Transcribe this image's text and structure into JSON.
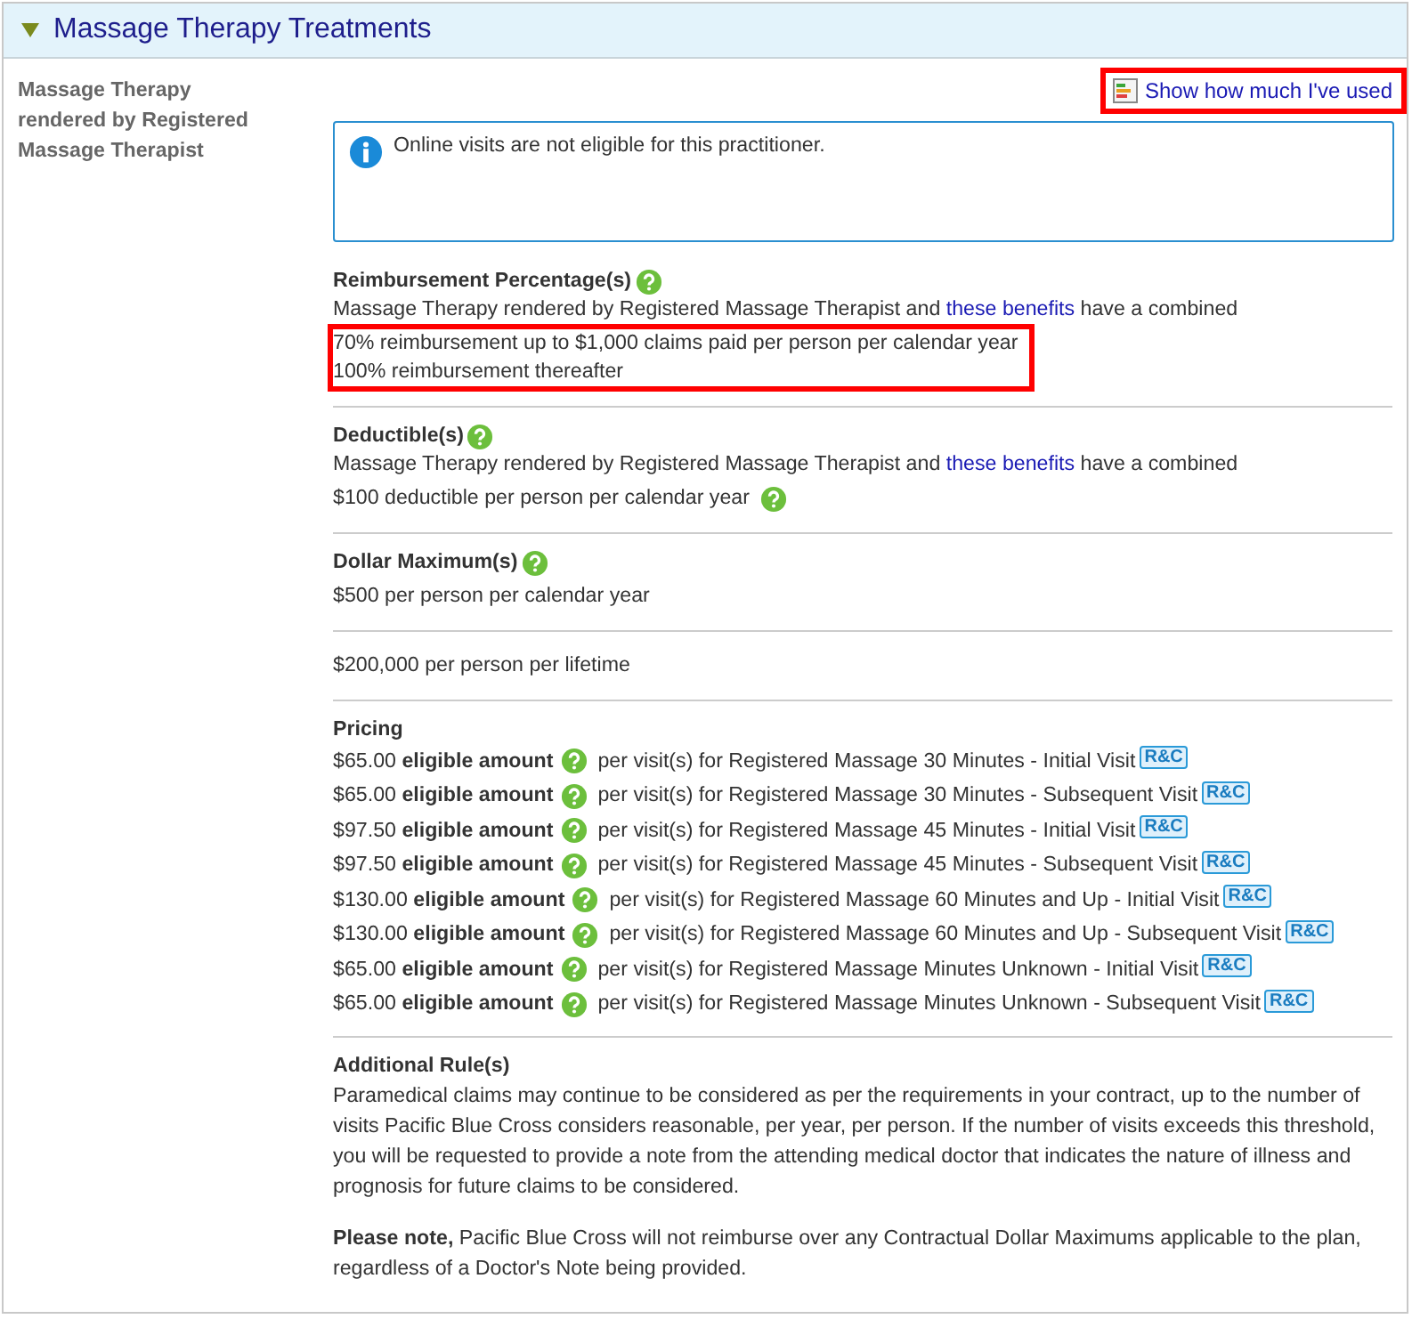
{
  "section": {
    "title": "Massage Therapy Treatments",
    "expanded": true,
    "label": "Massage Therapy rendered by Registered Massage Therapist",
    "usage_link": {
      "text": "Show how much I've used",
      "highlighted": true
    },
    "notice": "Online visits are not eligible for this practitioner.",
    "blocks": [
      {
        "kind": "text",
        "heading": "Reimbursement Percentage(s)",
        "heading_help": true,
        "intro": {
          "before": "Massage Therapy rendered by Registered Massage Therapist and ",
          "link": "these benefits",
          "after": " have a combined"
        },
        "highlighted": true,
        "lines": [
          {
            "text": "70% reimbursement up to $1,000 claims paid per person per calendar year",
            "help": false
          },
          {
            "text": "100% reimbursement thereafter",
            "help": false
          }
        ]
      },
      {
        "kind": "text",
        "heading": "Deductible(s)",
        "heading_help": true,
        "intro": {
          "before": "Massage Therapy rendered by Registered Massage Therapist and ",
          "link": "these benefits",
          "after": " have a combined"
        },
        "highlighted": false,
        "lines": [
          {
            "text": "$100 deductible per person per calendar year",
            "help": true
          }
        ]
      },
      {
        "kind": "text",
        "heading": "Dollar Maximum(s)",
        "heading_help": true,
        "highlighted": false,
        "lines": [
          {
            "text": "$500 per person per calendar year",
            "help": false
          }
        ]
      },
      {
        "kind": "text",
        "highlighted": false,
        "lines": [
          {
            "text": "$200,000 per person per lifetime",
            "help": false
          }
        ]
      },
      {
        "kind": "pricing",
        "heading": "Pricing",
        "rows": [
          {
            "amount": "$65.00",
            "label": "eligible amount",
            "description": "per visit(s) for Registered Massage 30 Minutes - Initial Visit",
            "tag": "R&C"
          },
          {
            "amount": "$65.00",
            "label": "eligible amount",
            "description": "per visit(s) for Registered Massage 30 Minutes - Subsequent Visit",
            "tag": "R&C"
          },
          {
            "amount": "$97.50",
            "label": "eligible amount",
            "description": "per visit(s) for Registered Massage 45 Minutes - Initial Visit",
            "tag": "R&C"
          },
          {
            "amount": "$97.50",
            "label": "eligible amount",
            "description": "per visit(s) for Registered Massage 45 Minutes - Subsequent Visit",
            "tag": "R&C"
          },
          {
            "amount": "$130.00",
            "label": "eligible amount",
            "description": "per visit(s) for Registered Massage 60 Minutes and Up - Initial Visit",
            "tag": "R&C"
          },
          {
            "amount": "$130.00",
            "label": "eligible amount",
            "description": "per visit(s) for Registered Massage 60 Minutes and Up - Subsequent Visit",
            "tag": "R&C"
          },
          {
            "amount": "$65.00",
            "label": "eligible amount",
            "description": "per visit(s) for Registered Massage Minutes Unknown - Initial Visit",
            "tag": "R&C"
          },
          {
            "amount": "$65.00",
            "label": "eligible amount",
            "description": "per visit(s) for Registered Massage Minutes Unknown - Subsequent Visit",
            "tag": "R&C"
          }
        ]
      },
      {
        "kind": "rules",
        "heading": "Additional Rule(s)",
        "paragraphs": [
          "Paramedical claims may continue to be considered as per the requirements in your contract, up to the number of visits Pacific Blue Cross considers reasonable, per year, per person.  If the number of visits exceeds this threshold, you will be requested to provide a note from the attending medical doctor that indicates the nature of illness and prognosis for future claims to be considered.",
          "**Please note,** Pacific Blue Cross will not reimburse over any Contractual Dollar Maximums applicable to the plan, regardless of a Doctor's Note being provided."
        ]
      }
    ]
  }
}
